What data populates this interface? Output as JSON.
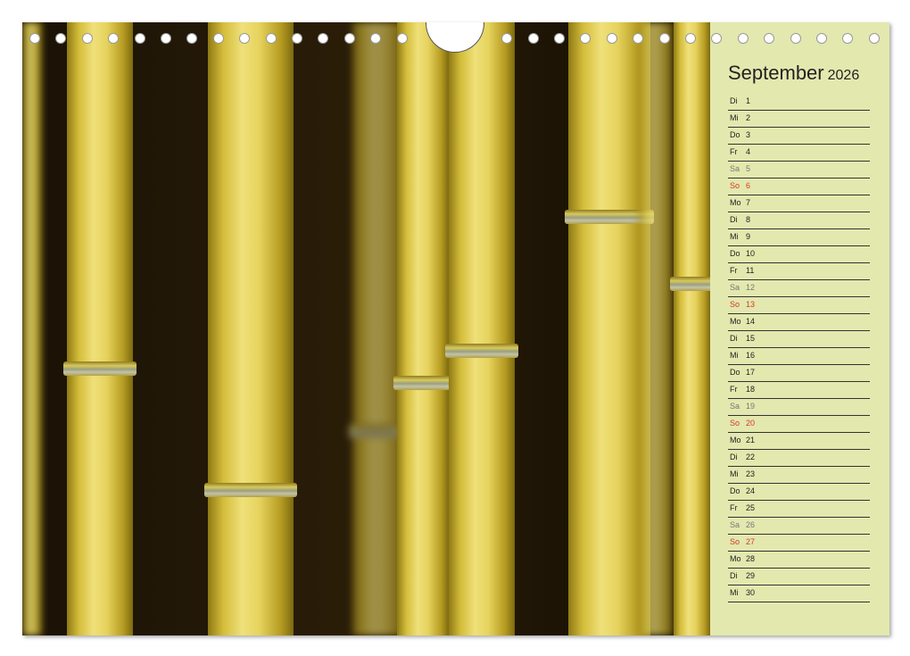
{
  "calendar": {
    "month": "September",
    "year": "2026"
  },
  "days": [
    {
      "wd": "Di",
      "d": "1",
      "type": "weekday"
    },
    {
      "wd": "Mi",
      "d": "2",
      "type": "weekday"
    },
    {
      "wd": "Do",
      "d": "3",
      "type": "weekday"
    },
    {
      "wd": "Fr",
      "d": "4",
      "type": "weekday"
    },
    {
      "wd": "Sa",
      "d": "5",
      "type": "saturday"
    },
    {
      "wd": "So",
      "d": "6",
      "type": "sunday"
    },
    {
      "wd": "Mo",
      "d": "7",
      "type": "weekday"
    },
    {
      "wd": "Di",
      "d": "8",
      "type": "weekday"
    },
    {
      "wd": "Mi",
      "d": "9",
      "type": "weekday"
    },
    {
      "wd": "Do",
      "d": "10",
      "type": "weekday"
    },
    {
      "wd": "Fr",
      "d": "11",
      "type": "weekday"
    },
    {
      "wd": "Sa",
      "d": "12",
      "type": "saturday"
    },
    {
      "wd": "So",
      "d": "13",
      "type": "sunday"
    },
    {
      "wd": "Mo",
      "d": "14",
      "type": "weekday"
    },
    {
      "wd": "Di",
      "d": "15",
      "type": "weekday"
    },
    {
      "wd": "Mi",
      "d": "16",
      "type": "weekday"
    },
    {
      "wd": "Do",
      "d": "17",
      "type": "weekday"
    },
    {
      "wd": "Fr",
      "d": "18",
      "type": "weekday"
    },
    {
      "wd": "Sa",
      "d": "19",
      "type": "saturday"
    },
    {
      "wd": "So",
      "d": "20",
      "type": "sunday"
    },
    {
      "wd": "Mo",
      "d": "21",
      "type": "weekday"
    },
    {
      "wd": "Di",
      "d": "22",
      "type": "weekday"
    },
    {
      "wd": "Mi",
      "d": "23",
      "type": "weekday"
    },
    {
      "wd": "Do",
      "d": "24",
      "type": "weekday"
    },
    {
      "wd": "Fr",
      "d": "25",
      "type": "weekday"
    },
    {
      "wd": "Sa",
      "d": "26",
      "type": "saturday"
    },
    {
      "wd": "So",
      "d": "27",
      "type": "sunday"
    },
    {
      "wd": "Mo",
      "d": "28",
      "type": "weekday"
    },
    {
      "wd": "Di",
      "d": "29",
      "type": "weekday"
    },
    {
      "wd": "Mi",
      "d": "30",
      "type": "weekday"
    }
  ],
  "colors": {
    "panel_background": "#e3e8ae",
    "sunday": "#d23a2a",
    "saturday": "#777777",
    "bamboo_yellow": "#e6d35d"
  },
  "photo": {
    "subject": "bamboo-stalks"
  }
}
